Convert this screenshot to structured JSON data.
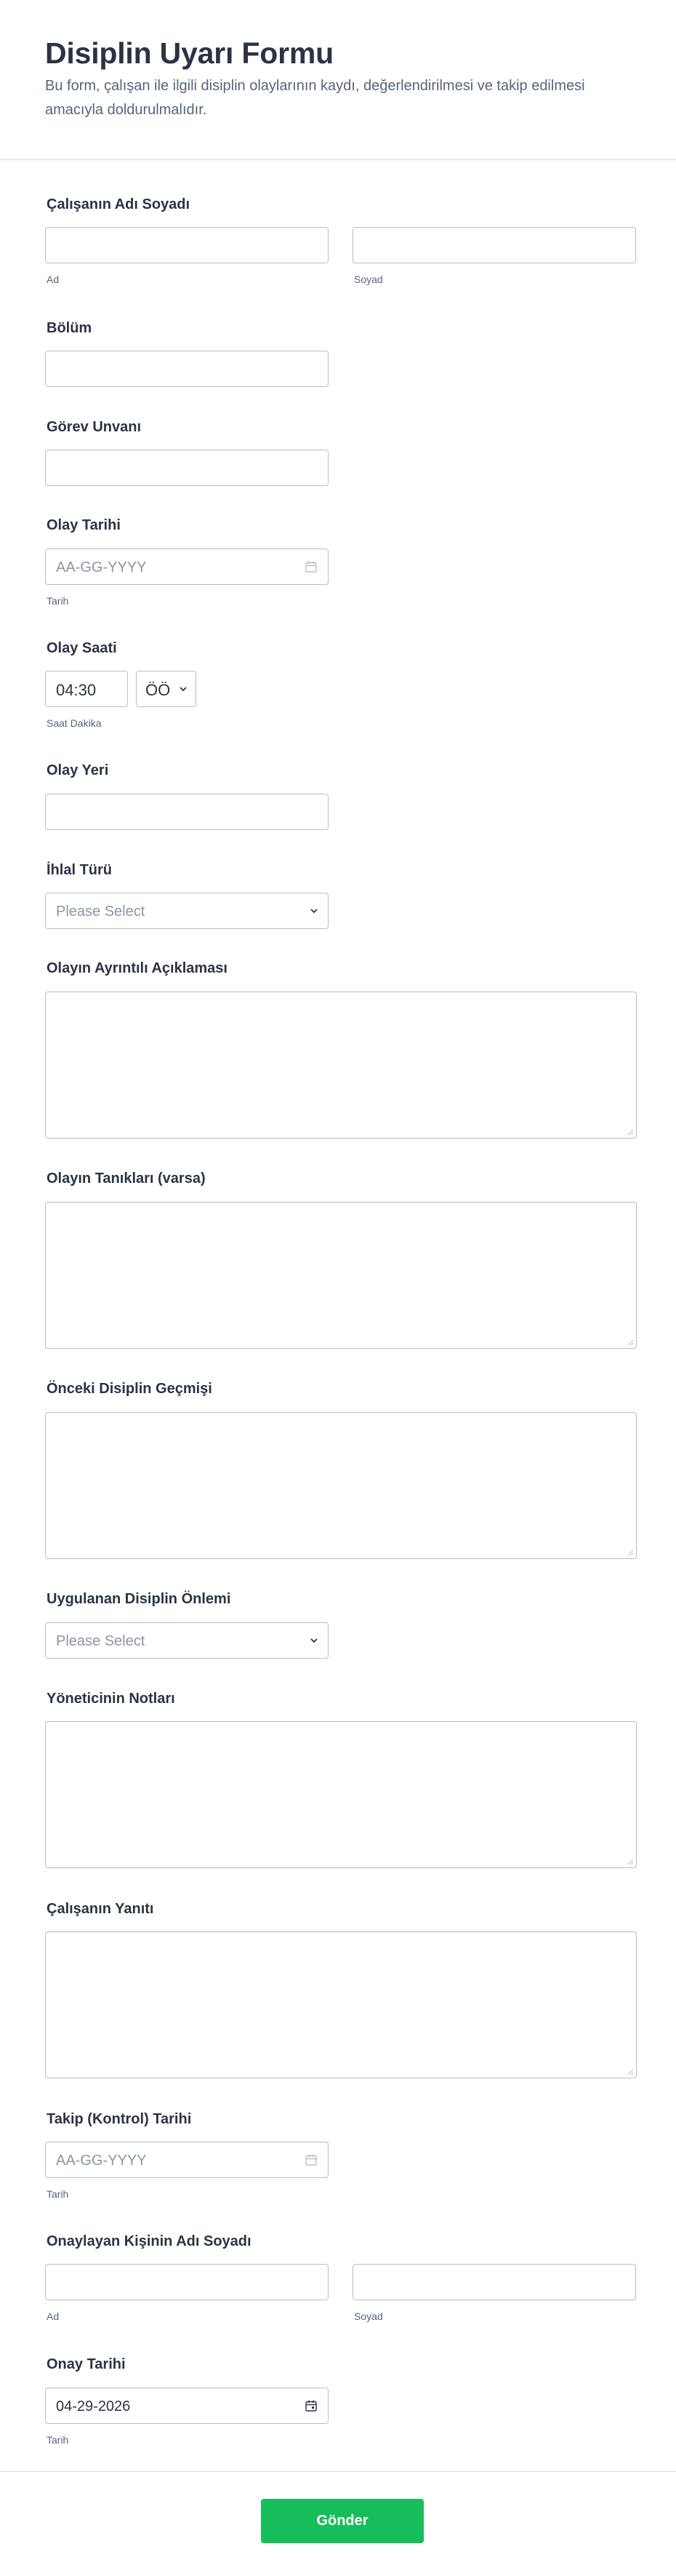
{
  "form": {
    "title": "Disiplin Uyarı Formu",
    "description": "Bu form, çalışan ile ilgili disiplin olaylarının kaydı, değerlendirilmesi ve takip edilmesi amacıyla doldurulmalıdır."
  },
  "fields": {
    "employee_name": {
      "label": "Çalışanın Adı Soyadı",
      "first_sub": "Ad",
      "last_sub": "Soyad"
    },
    "department": {
      "label": "Bölüm"
    },
    "job_title": {
      "label": "Görev Unvanı"
    },
    "incident_date": {
      "label": "Olay Tarihi",
      "placeholder": "AA-GG-YYYY",
      "sub": "Tarih"
    },
    "incident_time": {
      "label": "Olay Saati",
      "value": "04:30",
      "ampm": "ÖÖ",
      "sub": "Saat Dakika"
    },
    "incident_place": {
      "label": "Olay Yeri"
    },
    "violation_type": {
      "label": "İhlal Türü",
      "placeholder": "Please Select"
    },
    "incident_description": {
      "label": "Olayın Ayrıntılı Açıklaması"
    },
    "witnesses": {
      "label": "Olayın Tanıkları (varsa)"
    },
    "previous_history": {
      "label": "Önceki Disiplin Geçmişi"
    },
    "disciplinary_action": {
      "label": "Uygulanan Disiplin Önlemi",
      "placeholder": "Please Select"
    },
    "manager_notes": {
      "label": "Yöneticinin Notları"
    },
    "employee_response": {
      "label": "Çalışanın Yanıtı"
    },
    "followup_date": {
      "label": "Takip (Kontrol) Tarihi",
      "placeholder": "AA-GG-YYYY",
      "sub": "Tarih"
    },
    "approver_name": {
      "label": "Onaylayan Kişinin Adı Soyadı",
      "first_sub": "Ad",
      "last_sub": "Soyad"
    },
    "approval_date": {
      "label": "Onay Tarihi",
      "value": "04-29-2026",
      "sub": "Tarih"
    }
  },
  "submit": {
    "label": "Gönder"
  },
  "colors": {
    "submit_bg": "#18bd5b",
    "text": "#2c3345",
    "muted": "#57647e",
    "border": "#b8bdc9"
  }
}
